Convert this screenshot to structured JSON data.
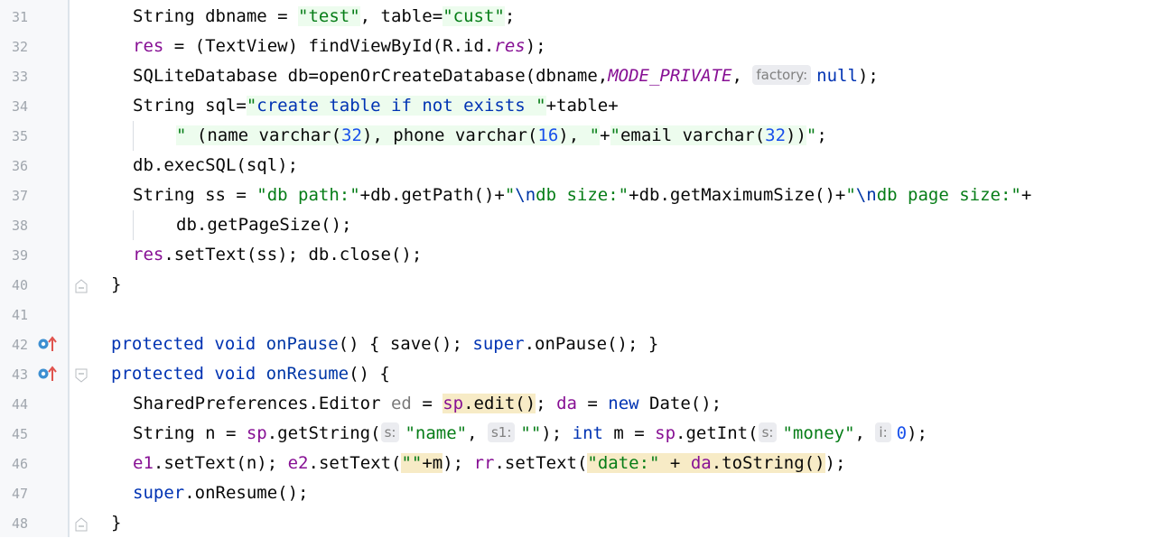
{
  "editor": {
    "lines": [
      {
        "num": "31",
        "indent": 2,
        "tokens": [
          {
            "t": "String dbname = "
          },
          {
            "t": "\"test\"",
            "c": "str hl-green"
          },
          {
            "t": ", table="
          },
          {
            "t": "\"cust\"",
            "c": "str hl-green"
          },
          {
            "t": ";"
          }
        ]
      },
      {
        "num": "32",
        "indent": 2,
        "tokens": [
          {
            "t": "res",
            "c": "fld"
          },
          {
            "t": " = (TextView) findViewById(R.id."
          },
          {
            "t": "res",
            "c": "itc"
          },
          {
            "t": ");"
          }
        ]
      },
      {
        "num": "33",
        "indent": 2,
        "tokens": [
          {
            "t": "SQLiteDatabase db=openOrCreateDatabase(dbname,"
          },
          {
            "t": "MODE_PRIVATE",
            "c": "itc"
          },
          {
            "t": ", "
          },
          {
            "hint": "factory:"
          },
          {
            "t": "null",
            "c": "kw"
          },
          {
            "t": ");"
          }
        ]
      },
      {
        "num": "34",
        "indent": 2,
        "tokens": [
          {
            "t": "String sql="
          },
          {
            "t": "\"",
            "c": "str hl-green"
          },
          {
            "t": "create table if not exists ",
            "c": "kw hl-green"
          },
          {
            "t": "\"",
            "c": "str hl-green"
          },
          {
            "t": "+table+"
          }
        ]
      },
      {
        "num": "35",
        "indent": 4,
        "guide": true,
        "tokens": [
          {
            "t": "\" ",
            "c": "str hl-green"
          },
          {
            "t": "(name varchar(",
            "c": "hl-green"
          },
          {
            "t": "32",
            "c": "num hl-green"
          },
          {
            "t": "), phone varchar(",
            "c": "hl-green"
          },
          {
            "t": "16",
            "c": "num hl-green"
          },
          {
            "t": "), ",
            "c": "hl-green"
          },
          {
            "t": "\"",
            "c": "str hl-green"
          },
          {
            "t": "+"
          },
          {
            "t": "\"",
            "c": "str hl-green"
          },
          {
            "t": "email varchar(",
            "c": "hl-green"
          },
          {
            "t": "32",
            "c": "num hl-green"
          },
          {
            "t": "))",
            "c": "hl-green"
          },
          {
            "t": "\"",
            "c": "str"
          },
          {
            "t": ";"
          }
        ]
      },
      {
        "num": "36",
        "indent": 2,
        "tokens": [
          {
            "t": "db.execSQL(sql);"
          }
        ]
      },
      {
        "num": "37",
        "indent": 2,
        "tokens": [
          {
            "t": "String ss = "
          },
          {
            "t": "\"db path:\"",
            "c": "str"
          },
          {
            "t": "+db.getPath()+"
          },
          {
            "t": "\"",
            "c": "str"
          },
          {
            "t": "\\n",
            "c": "esc"
          },
          {
            "t": "db size:\"",
            "c": "str"
          },
          {
            "t": "+db.getMaximumSize()+"
          },
          {
            "t": "\"",
            "c": "str"
          },
          {
            "t": "\\n",
            "c": "esc"
          },
          {
            "t": "db page size:\"",
            "c": "str"
          },
          {
            "t": "+"
          }
        ]
      },
      {
        "num": "38",
        "indent": 4,
        "guide": true,
        "tokens": [
          {
            "t": "db.getPageSize();"
          }
        ]
      },
      {
        "num": "39",
        "indent": 2,
        "tokens": [
          {
            "t": "res",
            "c": "fld"
          },
          {
            "t": ".setText(ss); db.close();"
          }
        ]
      },
      {
        "num": "40",
        "indent": 1,
        "fold": "end",
        "tokens": [
          {
            "t": "}"
          }
        ]
      },
      {
        "num": "41",
        "indent": 0,
        "tokens": []
      },
      {
        "num": "42",
        "indent": 1,
        "override": true,
        "tokens": [
          {
            "t": "protected void ",
            "c": "kw"
          },
          {
            "t": "onPause",
            "c": "esc"
          },
          {
            "t": "() { save(); "
          },
          {
            "t": "super",
            "c": "kw"
          },
          {
            "t": ".onPause(); }"
          }
        ]
      },
      {
        "num": "43",
        "indent": 1,
        "override": true,
        "fold": "start",
        "tokens": [
          {
            "t": "protected void ",
            "c": "kw"
          },
          {
            "t": "onResume",
            "c": "esc"
          },
          {
            "t": "() {"
          }
        ]
      },
      {
        "num": "44",
        "indent": 2,
        "tokens": [
          {
            "t": "SharedPreferences.Editor "
          },
          {
            "t": "ed",
            "c": "gray"
          },
          {
            "t": " = "
          },
          {
            "t": "sp",
            "c": "fld hl-yellow"
          },
          {
            "t": ".edit()",
            "c": "hl-yellow"
          },
          {
            "t": "; "
          },
          {
            "t": "da",
            "c": "fld"
          },
          {
            "t": " = "
          },
          {
            "t": "new ",
            "c": "kw"
          },
          {
            "t": "Date();"
          }
        ]
      },
      {
        "num": "45",
        "indent": 2,
        "tokens": [
          {
            "t": "String n = "
          },
          {
            "t": "sp",
            "c": "fld"
          },
          {
            "t": ".getString("
          },
          {
            "hint": "s:"
          },
          {
            "t": "\"name\"",
            "c": "str"
          },
          {
            "t": ", "
          },
          {
            "hint": "s1:"
          },
          {
            "t": "\"\"",
            "c": "str"
          },
          {
            "t": "); "
          },
          {
            "t": "int ",
            "c": "kw"
          },
          {
            "t": "m = "
          },
          {
            "t": "sp",
            "c": "fld"
          },
          {
            "t": ".getInt("
          },
          {
            "hint": "s:"
          },
          {
            "t": "\"money\"",
            "c": "str"
          },
          {
            "t": ", "
          },
          {
            "hint": "i:"
          },
          {
            "t": "0",
            "c": "num"
          },
          {
            "t": ");"
          }
        ]
      },
      {
        "num": "46",
        "indent": 2,
        "tokens": [
          {
            "t": "e1",
            "c": "fld"
          },
          {
            "t": ".setText(n); "
          },
          {
            "t": "e2",
            "c": "fld"
          },
          {
            "t": ".setText("
          },
          {
            "t": "\"\"",
            "c": "str hl-yellow"
          },
          {
            "t": "+m",
            "c": "hl-yellow"
          },
          {
            "t": "); "
          },
          {
            "t": "rr",
            "c": "fld"
          },
          {
            "t": ".setText("
          },
          {
            "t": "\"date:\"",
            "c": "str hl-yellow"
          },
          {
            "t": " + ",
            "c": "hl-yellow"
          },
          {
            "t": "da",
            "c": "fld hl-yellow"
          },
          {
            "t": ".toString()",
            "c": "hl-yellow"
          },
          {
            "t": ");"
          }
        ]
      },
      {
        "num": "47",
        "indent": 2,
        "tokens": [
          {
            "t": "super",
            "c": "kw"
          },
          {
            "t": ".onResume();"
          }
        ]
      },
      {
        "num": "48",
        "indent": 1,
        "fold": "end",
        "tokens": [
          {
            "t": "}"
          }
        ]
      }
    ],
    "colors": {
      "keyword": "#0033b3",
      "string": "#067d17",
      "number": "#1750eb",
      "field": "#871094",
      "gutter_bg": "#f7f8fa",
      "line_number": "#a0a6ad"
    },
    "icons": {
      "fold_end": "fold-end-icon",
      "fold_start": "fold-start-icon",
      "override": "override-method-icon"
    }
  }
}
